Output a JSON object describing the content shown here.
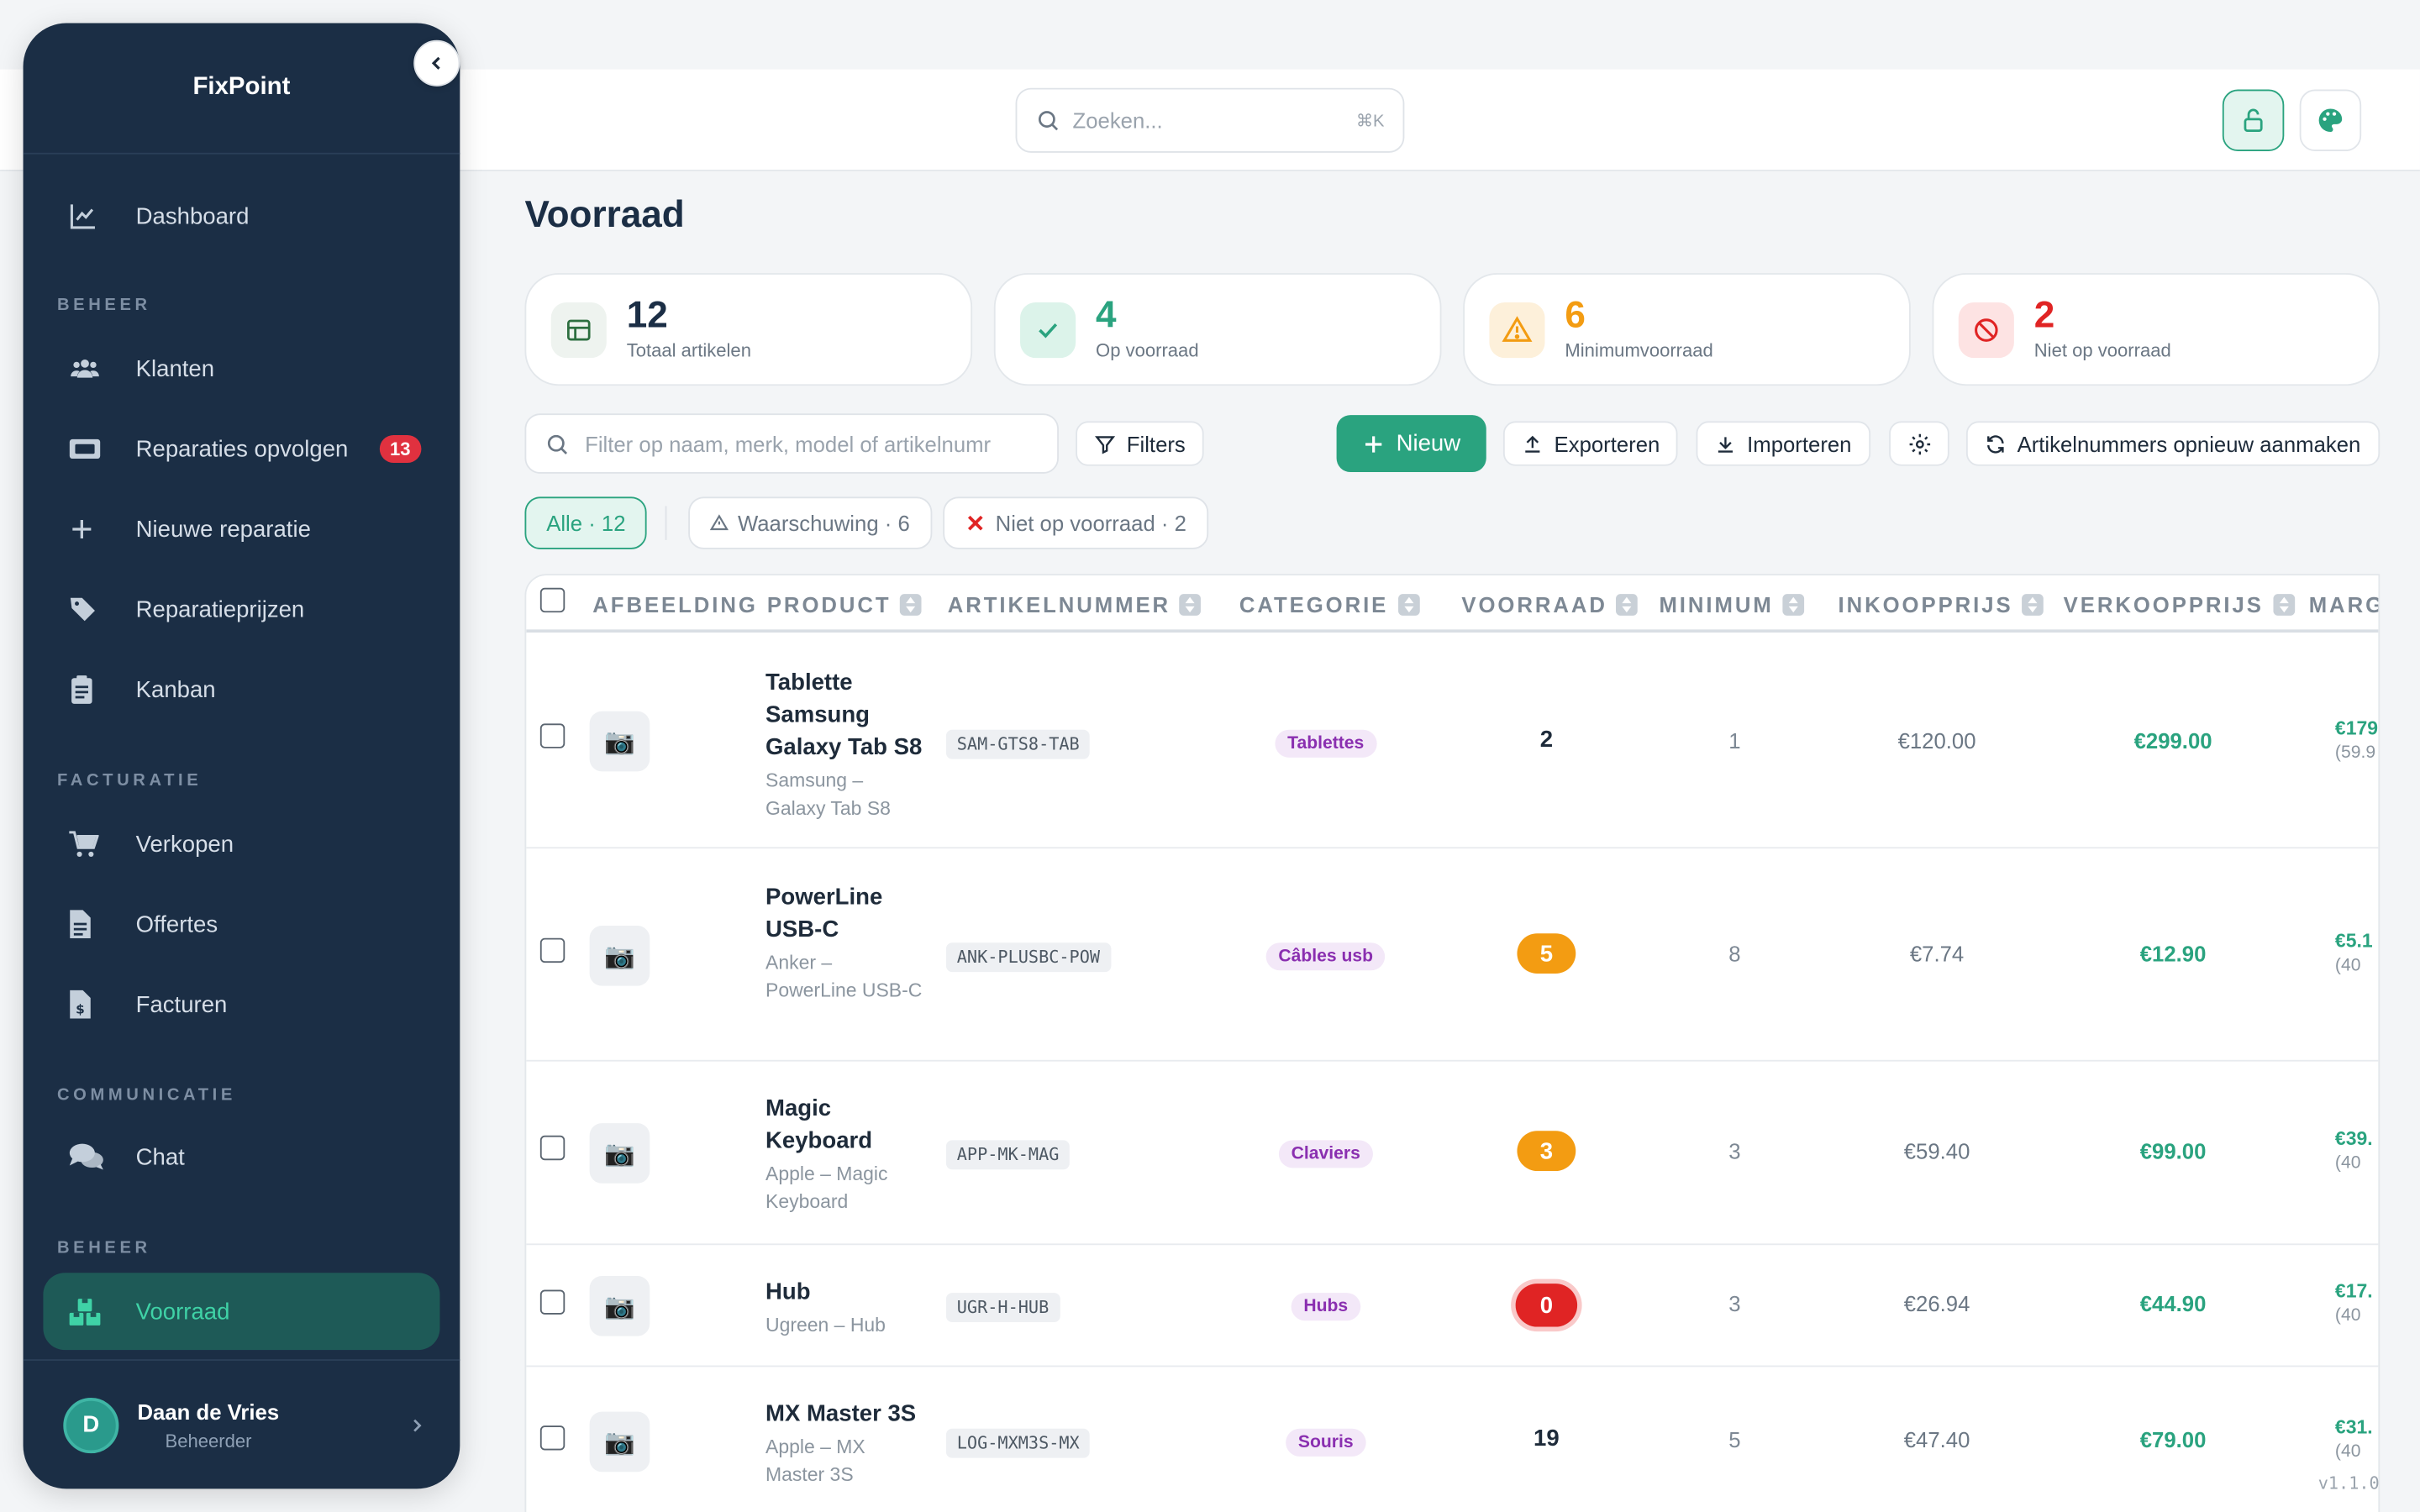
{
  "app": {
    "brand": "FixPoint",
    "version": "v1.1.0"
  },
  "topbar": {
    "search_placeholder": "Zoeken...",
    "search_shortcut": "⌘K"
  },
  "sidebar": {
    "items": [
      {
        "label": "Dashboard",
        "icon": "chart-line-icon"
      },
      {
        "label": "Klanten",
        "icon": "users-icon"
      },
      {
        "label": "Reparaties opvolgen",
        "icon": "ticket-icon",
        "badge": "13"
      },
      {
        "label": "Nieuwe reparatie",
        "icon": "plus-icon"
      },
      {
        "label": "Reparatieprijzen",
        "icon": "tags-icon"
      },
      {
        "label": "Kanban",
        "icon": "clipboard-icon"
      },
      {
        "label": "Verkopen",
        "icon": "cart-icon"
      },
      {
        "label": "Offertes",
        "icon": "document-icon"
      },
      {
        "label": "Facturen",
        "icon": "invoice-icon"
      },
      {
        "label": "Chat",
        "icon": "chat-icon"
      },
      {
        "label": "Voorraad",
        "icon": "boxes-icon",
        "active": true
      }
    ],
    "sections": [
      "BEHEER",
      "FACTURATIE",
      "COMMUNICATIE",
      "BEHEER"
    ],
    "user": {
      "initial": "D",
      "name": "Daan de Vries",
      "role": "Beheerder"
    }
  },
  "page": {
    "title": "Voorraad"
  },
  "stats": [
    {
      "value": "12",
      "label": "Totaal artikelen",
      "color": "#1b2e45"
    },
    {
      "value": "4",
      "label": "Op voorraad",
      "color": "#2aa37f"
    },
    {
      "value": "6",
      "label": "Minimumvoorraad",
      "color": "#f39c12"
    },
    {
      "value": "2",
      "label": "Niet op voorraad",
      "color": "#e02424"
    }
  ],
  "toolbar": {
    "filter_placeholder": "Filter op naam, merk, model of artikelnumr",
    "filters": "Filters",
    "new": "Nieuw",
    "export": "Exporteren",
    "import": "Importeren",
    "regenerate": "Artikelnummers opnieuw aanmaken"
  },
  "chips": {
    "all": "Alle · 12",
    "warning": "Waarschuwing · 6",
    "out": "Niet op voorraad · 2"
  },
  "table": {
    "headers": [
      "AFBEELDING",
      "PRODUCT",
      "ARTIKELNUMMER",
      "CATEGORIE",
      "VOORRAAD",
      "MINIMUM",
      "INKOOPPRIJS",
      "VERKOOPPRIJS",
      "MARG"
    ],
    "rows": [
      {
        "name": "Tablette Samsung Galaxy Tab S8",
        "sub": "Samsung – Galaxy Tab S8",
        "sku": "SAM-GTS8-TAB",
        "category": "Tablettes",
        "stock": "2",
        "stock_state": "ok",
        "min": "1",
        "buy": "€120.00",
        "sell": "€299.00",
        "margin": "€179",
        "margin_pct": "(59.9"
      },
      {
        "name": "PowerLine USB-C",
        "sub": "Anker – PowerLine USB-C",
        "sku": "ANK-PLUSBC-POW",
        "category": "Câbles usb",
        "stock": "5",
        "stock_state": "warn",
        "min": "8",
        "buy": "€7.74",
        "sell": "€12.90",
        "margin": "€5.1",
        "margin_pct": "(40"
      },
      {
        "name": "Magic Keyboard",
        "sub": "Apple – Magic Keyboard",
        "sku": "APP-MK-MAG",
        "category": "Claviers",
        "stock": "3",
        "stock_state": "warn",
        "min": "3",
        "buy": "€59.40",
        "sell": "€99.00",
        "margin": "€39.",
        "margin_pct": "(40"
      },
      {
        "name": "Hub",
        "sub": "Ugreen – Hub",
        "sku": "UGR-H-HUB",
        "category": "Hubs",
        "stock": "0",
        "stock_state": "out",
        "min": "3",
        "buy": "€26.94",
        "sell": "€44.90",
        "margin": "€17.",
        "margin_pct": "(40"
      },
      {
        "name": "MX Master 3S",
        "sub": "Apple – MX Master 3S",
        "sku": "LOG-MXM3S-MX",
        "category": "Souris",
        "stock": "19",
        "stock_state": "ok",
        "min": "5",
        "buy": "€47.40",
        "sell": "€79.00",
        "margin": "€31.",
        "margin_pct": "(40"
      }
    ]
  }
}
